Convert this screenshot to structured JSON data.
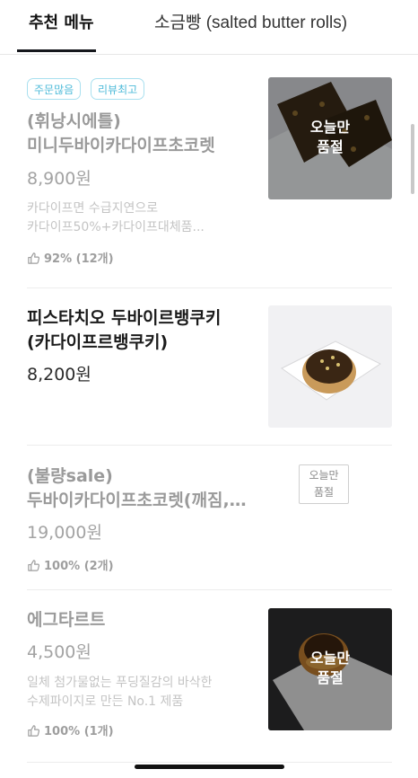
{
  "tabs": [
    {
      "label": "추천 메뉴",
      "active": true
    },
    {
      "label": "소금빵 (salted butter rolls)",
      "active": false
    }
  ],
  "colors": {
    "badge": "#4fbbd9",
    "active_tab_underline": "#15171c"
  },
  "items": [
    {
      "badges": [
        "주문많음",
        "리뷰최고"
      ],
      "name_line1": "(휘낭시에틀)",
      "name_line2": "미니두바이카다이프초코렛",
      "price": "8,900원",
      "desc_line1": "카다이프면 수급지연으로",
      "desc_line2": "카다이프50%+카다이프대체품...",
      "rating": "92% (12개)",
      "soldout": "오늘만 품절",
      "soldout_line1": "오늘만",
      "soldout_line2": "품절",
      "available": false
    },
    {
      "name_line1": "피스타치오 두바이르뱅쿠키",
      "name_line2": "(카다이프르뱅쿠키)",
      "price": "8,200원",
      "available": true
    },
    {
      "name_line1": "(불량sale)",
      "name_line2": "두바이카다이프초코렛(깨짐,…",
      "price": "19,000원",
      "rating": "100% (2개)",
      "soldout_line1": "오늘만",
      "soldout_line2": "품절",
      "available": false
    },
    {
      "name_line1": "에그타르트",
      "price": "4,500원",
      "desc_line1": "일체 첨가물없는 푸딩질감의 바삭한",
      "desc_line2": "수제파이지로 만든 No.1 제품",
      "rating": "100% (1개)",
      "soldout_line1": "오늘만",
      "soldout_line2": "품절",
      "available": false
    }
  ],
  "icons": {
    "rating": "thumbs-up-icon"
  }
}
